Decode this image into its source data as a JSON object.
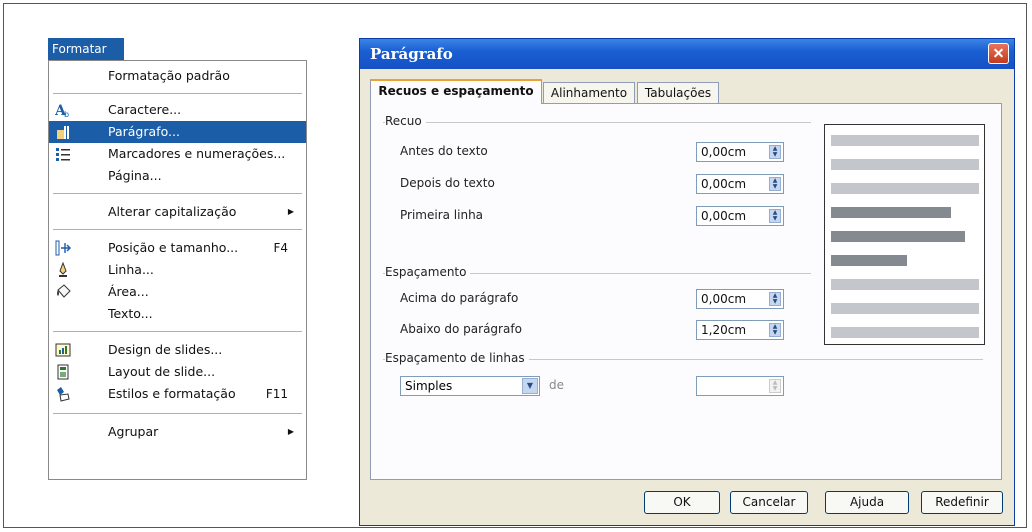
{
  "menu": {
    "title": "Formatar",
    "items": [
      {
        "label": "Formatação padrão",
        "shortcut": "",
        "icon": "",
        "has_submenu": false
      },
      {
        "label": "Caractere...",
        "shortcut": "",
        "icon": "character-icon",
        "has_submenu": false
      },
      {
        "label": "Parágrafo...",
        "shortcut": "",
        "icon": "paragraph-icon",
        "has_submenu": false,
        "selected": true
      },
      {
        "label": "Marcadores e numerações...",
        "shortcut": "",
        "icon": "bullets-numbering-icon",
        "has_submenu": false
      },
      {
        "label": "Página...",
        "shortcut": "",
        "icon": "",
        "has_submenu": false
      },
      {
        "label": "Alterar capitalização",
        "shortcut": "",
        "icon": "",
        "has_submenu": true
      },
      {
        "label": "Posição e tamanho...",
        "shortcut": "F4",
        "icon": "position-size-icon",
        "has_submenu": false
      },
      {
        "label": "Linha...",
        "shortcut": "",
        "icon": "line-icon",
        "has_submenu": false
      },
      {
        "label": "Área...",
        "shortcut": "",
        "icon": "area-icon",
        "has_submenu": false
      },
      {
        "label": "Texto...",
        "shortcut": "",
        "icon": "",
        "has_submenu": false
      },
      {
        "label": "Design de slides...",
        "shortcut": "",
        "icon": "slide-design-icon",
        "has_submenu": false
      },
      {
        "label": "Layout de slide...",
        "shortcut": "",
        "icon": "slide-layout-icon",
        "has_submenu": false
      },
      {
        "label": "Estilos e formatação",
        "shortcut": "F11",
        "icon": "styles-formatting-icon",
        "has_submenu": false
      },
      {
        "label": "Agrupar",
        "shortcut": "",
        "icon": "",
        "has_submenu": true
      }
    ]
  },
  "dialog": {
    "title": "Parágrafo",
    "tabs": [
      "Recuos e espaçamento",
      "Alinhamento",
      "Tabulações"
    ],
    "active_tab": 0,
    "indent": {
      "group_label": "Recuo",
      "before_text": {
        "label": "Antes do texto",
        "value": "0,00cm"
      },
      "after_text": {
        "label": "Depois do texto",
        "value": "0,00cm"
      },
      "first_line": {
        "label": "Primeira linha",
        "value": "0,00cm"
      }
    },
    "spacing": {
      "group_label": "Espaçamento",
      "above": {
        "label": "Acima do parágrafo",
        "value": "0,00cm"
      },
      "below": {
        "label": "Abaixo do parágrafo",
        "value": "1,20cm"
      }
    },
    "line_spacing": {
      "group_label": "Espaçamento de linhas",
      "selected": "Simples",
      "of_label": "de",
      "of_value": ""
    },
    "buttons": {
      "ok": "OK",
      "cancel": "Cancelar",
      "help": "Ajuda",
      "reset": "Redefinir"
    }
  },
  "colors": {
    "menu_highlight": "#1c5da8",
    "titlebar": "#1a5fd3",
    "close_button": "#d2472a",
    "active_tab_accent": "#e6a33a",
    "preview_light": "#c3c7cc",
    "preview_dark": "#858a90"
  }
}
